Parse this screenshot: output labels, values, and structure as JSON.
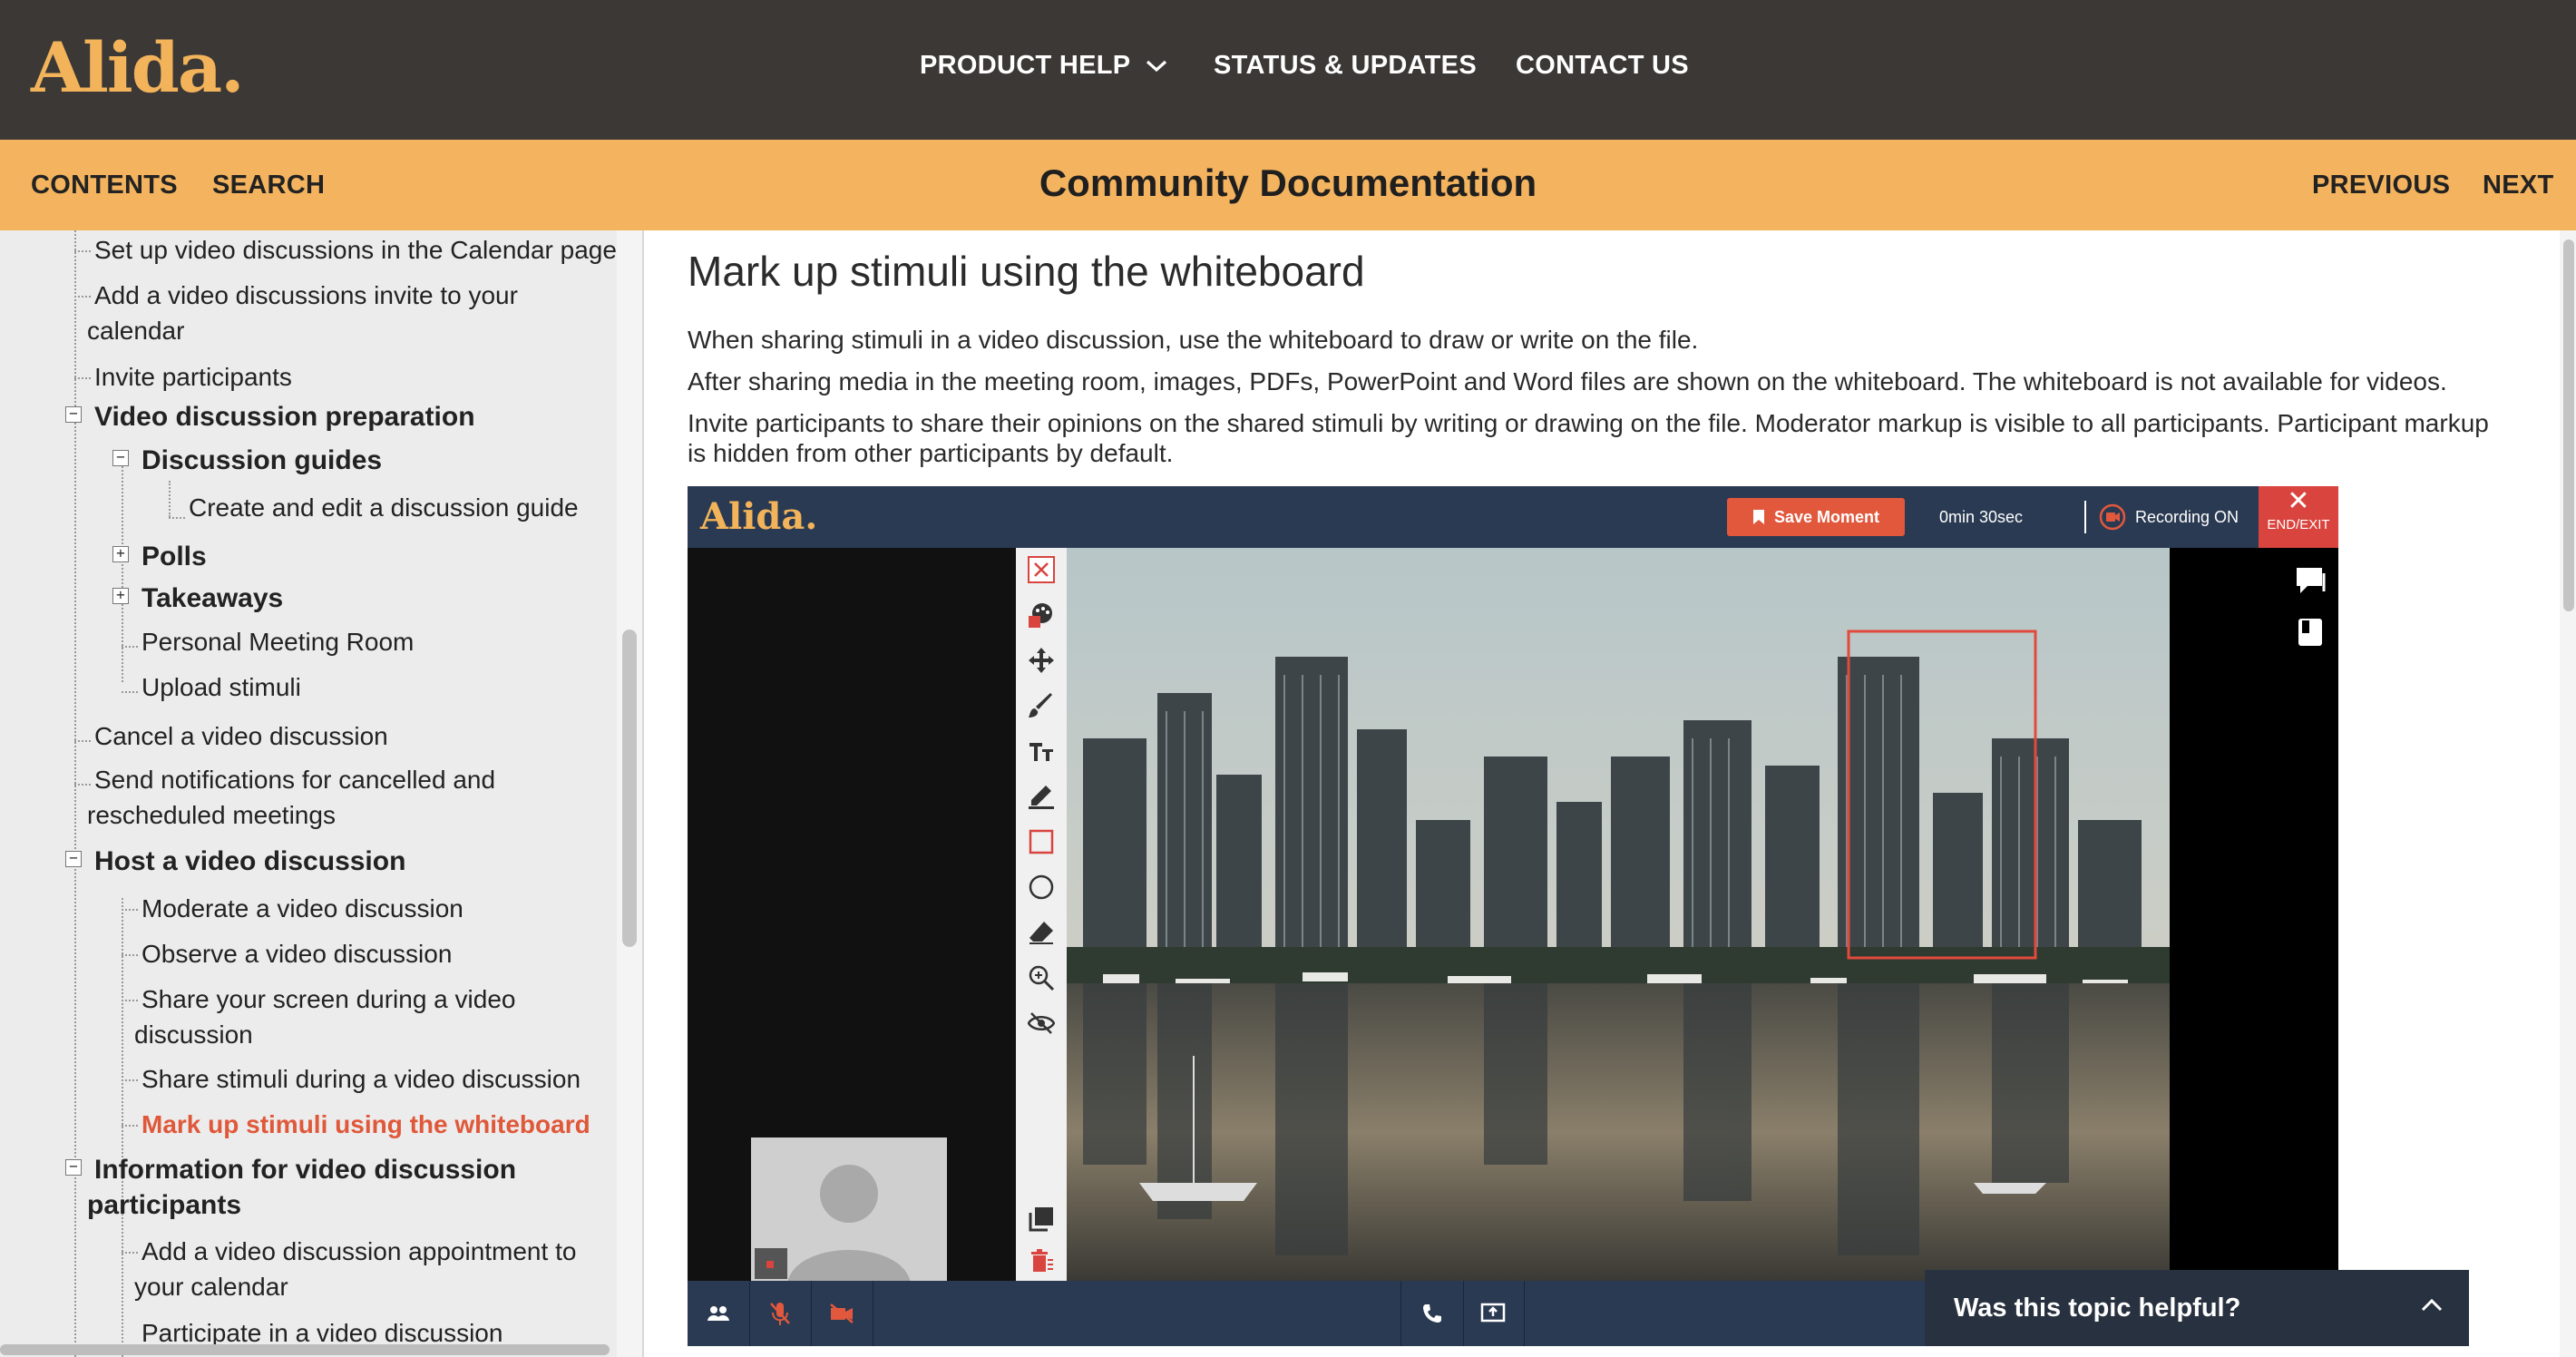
{
  "header": {
    "logo": "Alida.",
    "nav": [
      "PRODUCT HELP",
      "STATUS & UPDATES",
      "CONTACT US"
    ]
  },
  "subheader": {
    "contents": "CONTENTS",
    "search": "SEARCH",
    "title": "Community Documentation",
    "previous": "PREVIOUS",
    "next": "NEXT"
  },
  "toc": [
    "Set up video discussions in the Calendar page",
    "Add a video discussions invite to your calendar",
    "Invite participants",
    "Video discussion preparation",
    "Discussion guides",
    "Create and edit a discussion guide",
    "Polls",
    "Takeaways",
    "Personal Meeting Room",
    "Upload stimuli",
    "Cancel a video discussion",
    "Send notifications for cancelled and rescheduled meetings",
    "Host a video discussion",
    "Moderate a video discussion",
    "Observe a video discussion",
    "Share your screen during a video discussion",
    "Share stimuli during a video discussion",
    "Mark up stimuli using the whiteboard",
    "Information for video discussion participants",
    "Add a video discussion appointment to your calendar",
    "Participate in a video discussion"
  ],
  "article": {
    "title": "Mark up stimuli using the whiteboard",
    "paragraphs": [
      "When sharing stimuli in a video discussion, use the whiteboard to draw or write on the file.",
      "After sharing media in the meeting room, images, PDFs, PowerPoint and Word files are shown on the whiteboard. The whiteboard is not available for videos.",
      "Invite participants to share their opinions on the shared stimuli by writing or drawing on the file. Moderator markup is visible to all participants. Participant markup is hidden from other participants by default."
    ]
  },
  "screenshot": {
    "logo": "Alida.",
    "save_moment": "Save Moment",
    "timer": "0min 30sec",
    "recording": "Recording ON",
    "end_exit": "END/EXIT",
    "accent": "#e1583d"
  },
  "helpful": {
    "label": "Was this topic helpful?"
  },
  "colors": {
    "header_bg": "#3b3836",
    "brand": "#f2b35a",
    "subbar_bg": "#f4b35e",
    "active_link": "#e0583a"
  }
}
